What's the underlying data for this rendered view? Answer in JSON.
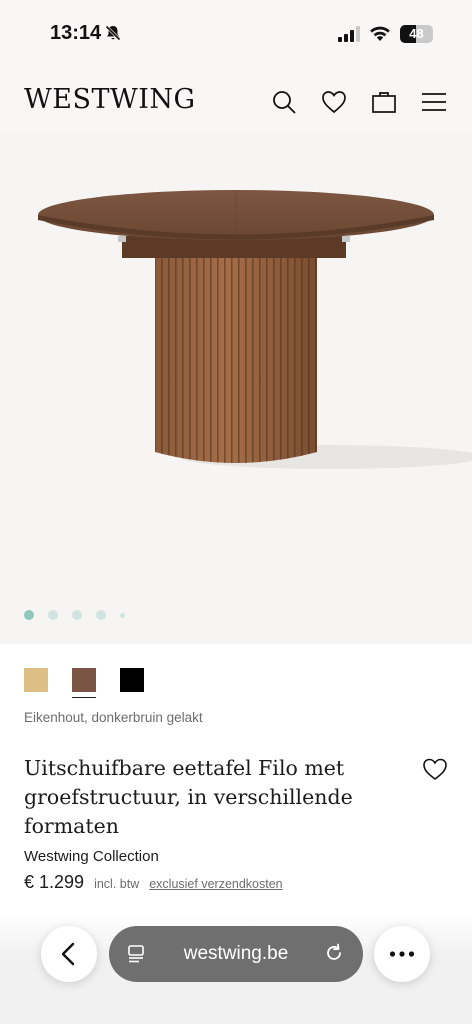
{
  "status": {
    "time": "13:14",
    "battery": "48",
    "battery_level": 0.48
  },
  "header": {
    "logo": "WESTWING"
  },
  "gallery": {
    "image_count": 5,
    "active_index": 0
  },
  "colors": {
    "swatches": [
      "#ddbe84",
      "#7a5444",
      "#000000"
    ],
    "selected_index": 1,
    "selected_name": "Eikenhout, donkerbruin gelakt"
  },
  "product": {
    "title": "Uitschuifbare eettafel Filo met groefstructuur, in verschillende formaten",
    "brand": "Westwing Collection",
    "price": "€ 1.299",
    "tax_note": "incl. btw",
    "shipping_link": "exclusief verzendkosten"
  },
  "browser": {
    "url": "westwing.be"
  }
}
